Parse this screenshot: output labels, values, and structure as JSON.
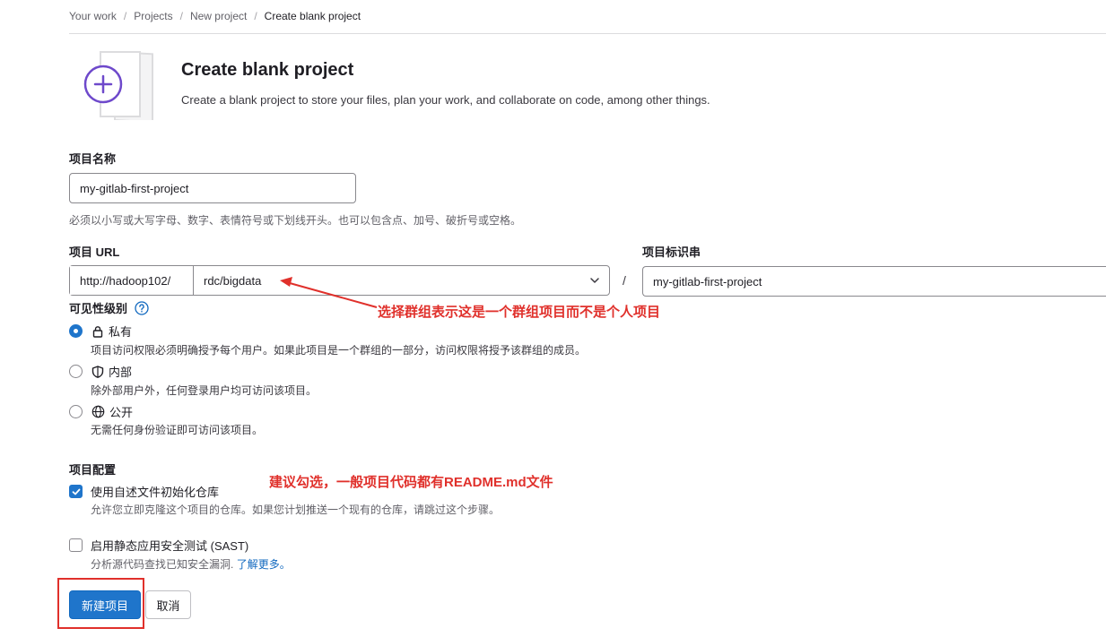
{
  "breadcrumb": {
    "items": [
      "Your work",
      "Projects",
      "New project",
      "Create blank project"
    ]
  },
  "header": {
    "title": "Create blank project",
    "subtitle": "Create a blank project to store your files, plan your work, and collaborate on code, among other things."
  },
  "project_name": {
    "label": "项目名称",
    "value": "my-gitlab-first-project",
    "help": "必须以小写或大写字母、数字、表情符号或下划线开头。也可以包含点、加号、破折号或空格。"
  },
  "project_url": {
    "label": "项目 URL",
    "prefix": "http://hadoop102/",
    "namespace": "rdc/bigdata",
    "separator": "/"
  },
  "project_slug": {
    "label": "项目标识串",
    "value": "my-gitlab-first-project"
  },
  "visibility": {
    "label": "可见性级别",
    "options": [
      {
        "label": "私有",
        "desc": "项目访问权限必须明确授予每个用户。如果此项目是一个群组的一部分，访问权限将授予该群组的成员。",
        "checked": true,
        "icon": "lock-icon"
      },
      {
        "label": "内部",
        "desc": "除外部用户外，任何登录用户均可访问该项目。",
        "checked": false,
        "icon": "shield-icon"
      },
      {
        "label": "公开",
        "desc": "无需任何身份验证即可访问该项目。",
        "checked": false,
        "icon": "globe-icon"
      }
    ]
  },
  "config": {
    "label": "项目配置",
    "readme": {
      "label": "使用自述文件初始化仓库",
      "desc": "允许您立即克隆这个项目的仓库。如果您计划推送一个现有的仓库，请跳过这个步骤。",
      "checked": true
    },
    "sast": {
      "label": "启用静态应用安全测试 (SAST)",
      "desc": "分析源代码查找已知安全漏洞.",
      "link": "了解更多。",
      "checked": false
    }
  },
  "buttons": {
    "create": "新建项目",
    "cancel": "取消"
  },
  "annotations": {
    "group_note": "选择群组表示这是一个群组项目而不是个人项目",
    "readme_note": "建议勾选，一般项目代码都有README.md文件",
    "color": "#e0302b"
  },
  "colors": {
    "primary": "#1f75cb",
    "illustration_accent": "#6e49cb"
  }
}
